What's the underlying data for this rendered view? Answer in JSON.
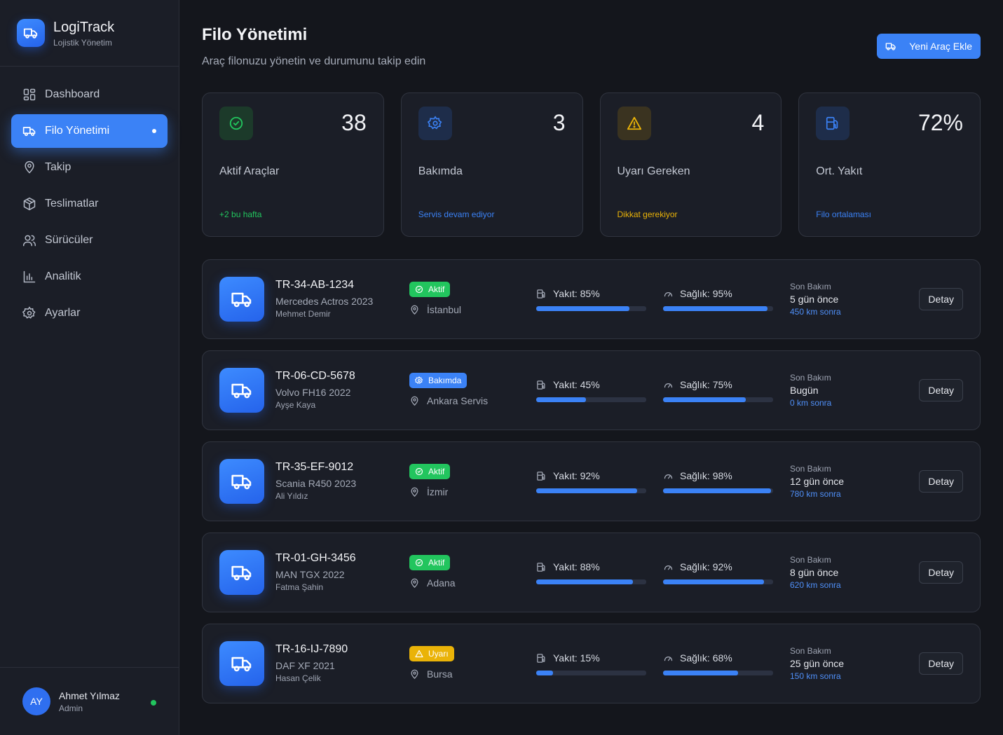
{
  "brand": {
    "title": "LogiTrack",
    "subtitle": "Lojistik Yönetim"
  },
  "nav": [
    {
      "label": "Dashboard",
      "icon": "dashboard-icon",
      "active": false
    },
    {
      "label": "Filo Yönetimi",
      "icon": "truck-icon",
      "active": true
    },
    {
      "label": "Takip",
      "icon": "map-pin-icon",
      "active": false
    },
    {
      "label": "Teslimatlar",
      "icon": "package-icon",
      "active": false
    },
    {
      "label": "Sürücüler",
      "icon": "users-icon",
      "active": false
    },
    {
      "label": "Analitik",
      "icon": "bar-chart-icon",
      "active": false
    },
    {
      "label": "Ayarlar",
      "icon": "gear-icon",
      "active": false
    }
  ],
  "user": {
    "initials": "AY",
    "name": "Ahmet Yılmaz",
    "role": "Admin",
    "status_color": "#22c55e"
  },
  "header": {
    "title": "Filo Yönetimi",
    "subtitle": "Araç filonuzu yönetin ve durumunu takip edin",
    "add_button": "Yeni Araç Ekle"
  },
  "stats": [
    {
      "icon": "check-circle-icon",
      "value": "38",
      "label": "Aktif Araçlar",
      "note": "+2 bu hafta",
      "color": "#22c55e",
      "bg": "#1c3a2a"
    },
    {
      "icon": "gear-icon",
      "value": "3",
      "label": "Bakımda",
      "note": "Servis devam ediyor",
      "color": "#3b82f6",
      "bg": "#1e2d4a"
    },
    {
      "icon": "warning-icon",
      "value": "4",
      "label": "Uyarı Gereken",
      "note": "Dikkat gerekiyor",
      "color": "#eab308",
      "bg": "#3a3320"
    },
    {
      "icon": "fuel-icon",
      "value": "72%",
      "label": "Ort. Yakıt",
      "note": "Filo ortalaması",
      "color": "#3b82f6",
      "bg": "#1e2d4a"
    }
  ],
  "vehicles": [
    {
      "plate": "TR-34-AB-1234",
      "model": "Mercedes Actros 2023",
      "driver": "Mehmet Demir",
      "status": "Aktif",
      "status_type": "active",
      "location": "İstanbul",
      "fuel_label": "Yakıt: 85%",
      "fuel": 85,
      "health_label": "Sağlık: 95%",
      "health": 95,
      "maint_label": "Son Bakım",
      "maint_when": "5 gün önce",
      "maint_km": "450 km sonra",
      "detail": "Detay"
    },
    {
      "plate": "TR-06-CD-5678",
      "model": "Volvo FH16 2022",
      "driver": "Ayşe Kaya",
      "status": "Bakımda",
      "status_type": "maintenance",
      "location": "Ankara Servis",
      "fuel_label": "Yakıt: 45%",
      "fuel": 45,
      "health_label": "Sağlık: 75%",
      "health": 75,
      "maint_label": "Son Bakım",
      "maint_when": "Bugün",
      "maint_km": "0 km sonra",
      "detail": "Detay"
    },
    {
      "plate": "TR-35-EF-9012",
      "model": "Scania R450 2023",
      "driver": "Ali Yıldız",
      "status": "Aktif",
      "status_type": "active",
      "location": "İzmir",
      "fuel_label": "Yakıt: 92%",
      "fuel": 92,
      "health_label": "Sağlık: 98%",
      "health": 98,
      "maint_label": "Son Bakım",
      "maint_when": "12 gün önce",
      "maint_km": "780 km sonra",
      "detail": "Detay"
    },
    {
      "plate": "TR-01-GH-3456",
      "model": "MAN TGX 2022",
      "driver": "Fatma Şahin",
      "status": "Aktif",
      "status_type": "active",
      "location": "Adana",
      "fuel_label": "Yakıt: 88%",
      "fuel": 88,
      "health_label": "Sağlık: 92%",
      "health": 92,
      "maint_label": "Son Bakım",
      "maint_when": "8 gün önce",
      "maint_km": "620 km sonra",
      "detail": "Detay"
    },
    {
      "plate": "TR-16-IJ-7890",
      "model": "DAF XF 2021",
      "driver": "Hasan Çelik",
      "status": "Uyarı",
      "status_type": "warning",
      "location": "Bursa",
      "fuel_label": "Yakıt: 15%",
      "fuel": 15,
      "health_label": "Sağlık: 68%",
      "health": 68,
      "maint_label": "Son Bakım",
      "maint_when": "25 gün önce",
      "maint_km": "150 km sonra",
      "detail": "Detay"
    }
  ],
  "status_colors": {
    "active": "#22c55e",
    "maintenance": "#3b82f6",
    "warning": "#eab308"
  }
}
